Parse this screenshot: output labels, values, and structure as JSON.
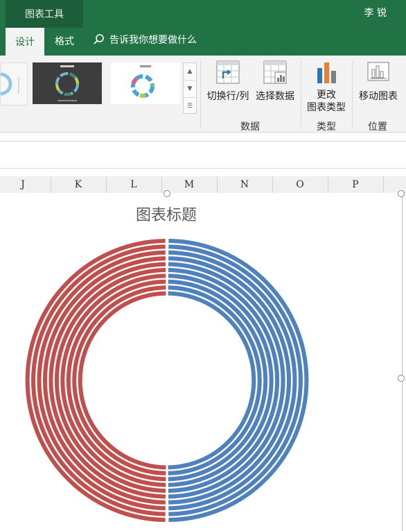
{
  "window": {
    "contextual_tab_group": "图表工具",
    "user": "李 锐"
  },
  "tabs": [
    {
      "label": "设计",
      "active": true
    },
    {
      "label": "格式",
      "active": false
    }
  ],
  "tell_me": {
    "placeholder": "告诉我你想要做什么",
    "icon": "lightbulb-search-icon"
  },
  "ribbon": {
    "buttons": {
      "switch_row_col": "切换行/列",
      "select_data": "选择数据",
      "change_type_line1": "更改",
      "change_type_line2": "图表类型",
      "move_chart": "移动图表"
    },
    "groups": {
      "data": "数据",
      "type": "类型",
      "location": "位置"
    }
  },
  "columns": [
    "J",
    "K",
    "L",
    "M",
    "N",
    "O",
    "P"
  ],
  "colors": {
    "ribbon_green": "#217346",
    "series_blue": "#4f81bd",
    "series_red": "#c0504d"
  },
  "chart_data": {
    "type": "pie",
    "subtype": "doughnut",
    "title": "图表标题",
    "rings": [
      {
        "blue": 0.5,
        "red": 0.5
      },
      {
        "blue": 0.5,
        "red": 0.5
      },
      {
        "blue": 0.5,
        "red": 0.5
      },
      {
        "blue": 0.5,
        "red": 0.5
      },
      {
        "blue": 0.5,
        "red": 0.5
      },
      {
        "blue": 0.5,
        "red": 0.5
      },
      {
        "blue": 0.5,
        "red": 0.5
      },
      {
        "blue": 0.5,
        "red": 0.5
      },
      {
        "blue": 0.5,
        "red": 0.5
      },
      {
        "blue": 0.5,
        "red": 0.5
      }
    ]
  }
}
